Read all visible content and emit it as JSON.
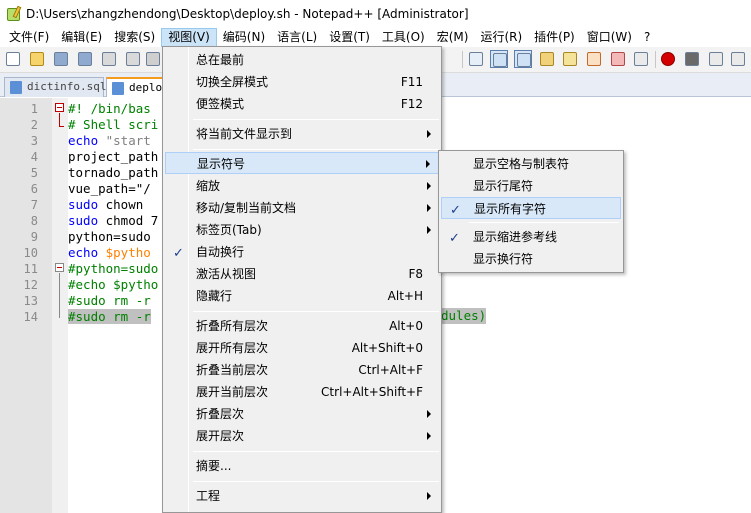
{
  "window": {
    "title": "D:\\Users\\zhangzhendong\\Desktop\\deploy.sh - Notepad++ [Administrator]"
  },
  "menubar": [
    {
      "label": "文件(F)"
    },
    {
      "label": "编辑(E)"
    },
    {
      "label": "搜索(S)"
    },
    {
      "label": "视图(V)"
    },
    {
      "label": "编码(N)"
    },
    {
      "label": "语言(L)"
    },
    {
      "label": "设置(T)"
    },
    {
      "label": "工具(O)"
    },
    {
      "label": "宏(M)"
    },
    {
      "label": "运行(R)"
    },
    {
      "label": "插件(P)"
    },
    {
      "label": "窗口(W)"
    },
    {
      "label": "?"
    }
  ],
  "tabs": [
    {
      "label": "dictinfo.sql"
    },
    {
      "label": "deplo"
    }
  ],
  "editor": {
    "line_numbers": [
      "1",
      "2",
      "3",
      "4",
      "5",
      "6",
      "7",
      "8",
      "9",
      "10",
      "11",
      "12",
      "13",
      "14"
    ],
    "lines": [
      [
        {
          "t": "#! /bin/bas",
          "c": "c-comment"
        }
      ],
      [
        {
          "t": "# Shell scri",
          "c": "c-comment"
        }
      ],
      [
        {
          "t": "echo",
          "c": "c-kw"
        },
        {
          "t": " \"start",
          "c": "c-str"
        }
      ],
      [
        {
          "t": "project_path",
          "c": "c-plain"
        }
      ],
      [
        {
          "t": "tornado_path",
          "c": "c-plain"
        }
      ],
      [
        {
          "t": "vue_path=\"/",
          "c": "c-plain"
        }
      ],
      [
        {
          "t": "sudo",
          "c": "c-kw"
        },
        {
          "t": " chown ",
          "c": "c-plain"
        }
      ],
      [
        {
          "t": "sudo",
          "c": "c-kw"
        },
        {
          "t": " chmod 7",
          "c": "c-plain"
        }
      ],
      [
        {
          "t": "python=sudo",
          "c": "c-plain"
        }
      ],
      [
        {
          "t": "echo",
          "c": "c-kw"
        },
        {
          "t": " $pytho",
          "c": "c-var"
        }
      ],
      [
        {
          "t": "#python=sudo",
          "c": "c-comment"
        }
      ],
      [
        {
          "t": "#echo $pytho",
          "c": "c-comment"
        }
      ],
      [
        {
          "t": "#sudo rm -r",
          "c": "c-comment"
        }
      ],
      [
        {
          "t": "#sudo rm -r",
          "c": "c-comment"
        }
      ]
    ],
    "line14_tail": "dules)"
  },
  "view_menu": {
    "items": [
      {
        "label": "总在最前",
        "accel": ""
      },
      {
        "label": "切换全屏模式",
        "accel": "F11"
      },
      {
        "label": "便签模式",
        "accel": "F12"
      },
      {
        "label": "将当前文件显示到",
        "accel": ""
      },
      {
        "label": "显示符号",
        "accel": ""
      },
      {
        "label": "缩放",
        "accel": ""
      },
      {
        "label": "移动/复制当前文档",
        "accel": ""
      },
      {
        "label": "标签页(Tab)",
        "accel": ""
      },
      {
        "label": "自动换行",
        "accel": ""
      },
      {
        "label": "激活从视图",
        "accel": "F8"
      },
      {
        "label": "隐藏行",
        "accel": "Alt+H"
      },
      {
        "label": "折叠所有层次",
        "accel": "Alt+0"
      },
      {
        "label": "展开所有层次",
        "accel": "Alt+Shift+0"
      },
      {
        "label": "折叠当前层次",
        "accel": "Ctrl+Alt+F"
      },
      {
        "label": "展开当前层次",
        "accel": "Ctrl+Alt+Shift+F"
      },
      {
        "label": "折叠层次",
        "accel": ""
      },
      {
        "label": "展开层次",
        "accel": ""
      },
      {
        "label": "摘要...",
        "accel": ""
      },
      {
        "label": "工程",
        "accel": ""
      }
    ],
    "check_mark": "✓"
  },
  "symbols_submenu": {
    "items": [
      {
        "label": "显示空格与制表符"
      },
      {
        "label": "显示行尾符"
      },
      {
        "label": "显示所有字符"
      },
      {
        "label": "显示缩进参考线"
      },
      {
        "label": "显示换行符"
      }
    ]
  }
}
